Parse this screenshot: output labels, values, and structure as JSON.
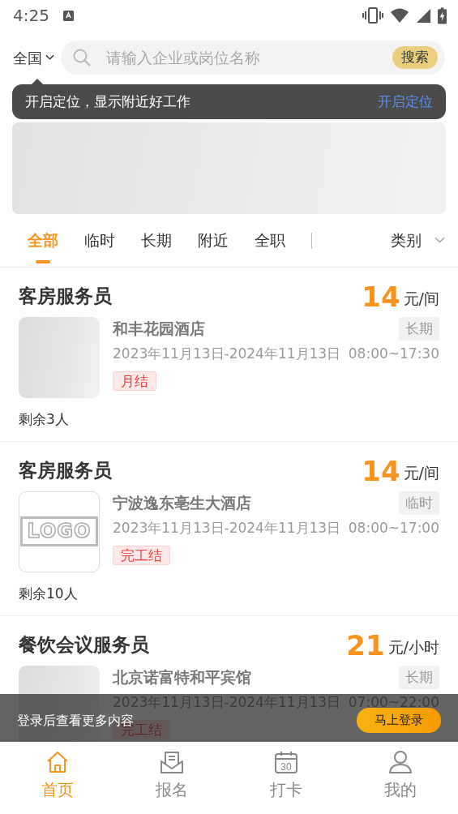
{
  "status_bar": {
    "time": "4:25"
  },
  "search": {
    "region": "全国",
    "placeholder": "请输入企业或岗位名称",
    "button": "搜索"
  },
  "location_tip": {
    "text": "开启定位，显示附近好工作",
    "action": "开启定位"
  },
  "tabs": [
    {
      "label": "全部",
      "selected": true
    },
    {
      "label": "临时",
      "selected": false
    },
    {
      "label": "长期",
      "selected": false
    },
    {
      "label": "附近",
      "selected": false
    },
    {
      "label": "全职",
      "selected": false
    }
  ],
  "category": {
    "label": "类别"
  },
  "jobs": [
    {
      "title": "客房服务员",
      "price": "14",
      "unit": "元/间",
      "thumbnail": {
        "kind": "blank"
      },
      "company": "和丰花园酒店",
      "term": "长期",
      "dates": "2023年11月13日-2024年11月13日",
      "hours": "08:00~17:30",
      "pay": "月结",
      "remaining": "剩余3人"
    },
    {
      "title": "客房服务员",
      "price": "14",
      "unit": "元/间",
      "thumbnail": {
        "kind": "logo",
        "text": "LOGO"
      },
      "company": "宁波逸东亳生大酒店",
      "term": "临时",
      "dates": "2023年11月13日-2024年11月13日",
      "hours": "08:00~17:00",
      "pay": "完工结",
      "remaining": "剩余10人"
    },
    {
      "title": "餐饮会议服务员",
      "price": "21",
      "unit": "元/小时",
      "thumbnail": {
        "kind": "blank"
      },
      "company": "北京诺富特和平宾馆",
      "term": "长期",
      "dates": "2023年11月13日-2024年11月13日",
      "hours": "07:00~22:00",
      "pay": "完工结"
    }
  ],
  "login_bar": {
    "text": "登录后查看更多内容",
    "button": "马上登录"
  },
  "bottom_nav": [
    {
      "label": "首页",
      "kind": "home",
      "selected": true
    },
    {
      "label": "报名",
      "kind": "mail",
      "selected": false
    },
    {
      "label": "打卡",
      "kind": "calendar",
      "icon_text": "30",
      "selected": false
    },
    {
      "label": "我的",
      "kind": "person",
      "selected": false
    }
  ]
}
